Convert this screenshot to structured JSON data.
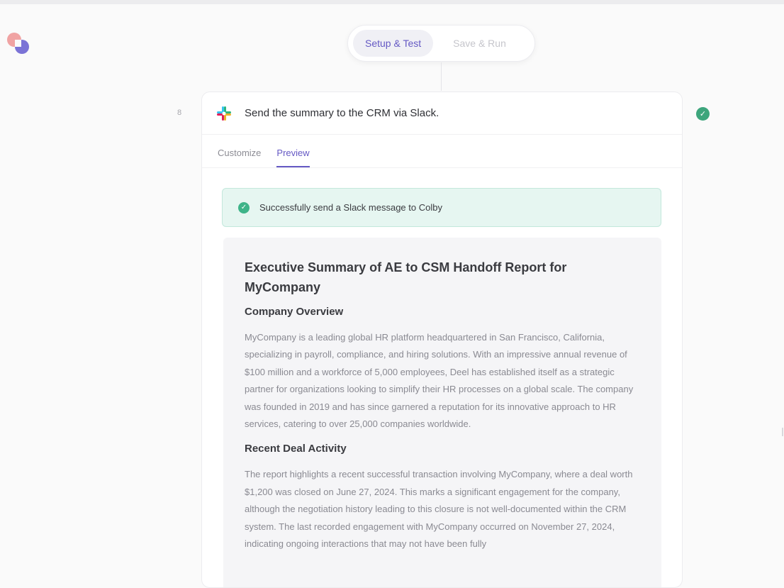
{
  "modes": {
    "setup_test": "Setup & Test",
    "save_run": "Save & Run"
  },
  "step": {
    "number": "8",
    "title": "Send the summary to the CRM via Slack.",
    "icon": "slack-icon",
    "status_icon": "check-circle-icon"
  },
  "tabs": [
    {
      "label": "Customize",
      "active": false
    },
    {
      "label": "Preview",
      "active": true
    }
  ],
  "alert": {
    "text": "Successfully send a Slack message to Colby"
  },
  "report": {
    "title_line1": "Executive Summary of AE to CSM Handoff Report for",
    "title_line2": "MyCompany",
    "section1": {
      "heading": "Company Overview",
      "body": "MyCompany is a leading global HR platform headquartered in San Francisco, California, specializing in payroll, compliance, and hiring solutions. With an impressive annual revenue of $100 million and a workforce of 5,000 employees, Deel has established itself as a strategic partner for organizations looking to simplify their HR processes on a global scale. The company was founded in 2019 and has since garnered a reputation for its innovative approach to HR services, catering to over 25,000 companies worldwide."
    },
    "section2": {
      "heading": "Recent Deal Activity",
      "body": "The report highlights a recent successful transaction involving MyCompany, where a deal worth $1,200 was closed on June 27, 2024. This marks a significant engagement for the company, although the negotiation history leading to this closure is not well-documented within the CRM system. The last recorded engagement with MyCompany occurred on November 27, 2024, indicating ongoing interactions that may not have been fully"
    }
  },
  "colors": {
    "accent": "#6559c4",
    "success": "#3eb489",
    "success_bg": "#e6f6f1"
  }
}
